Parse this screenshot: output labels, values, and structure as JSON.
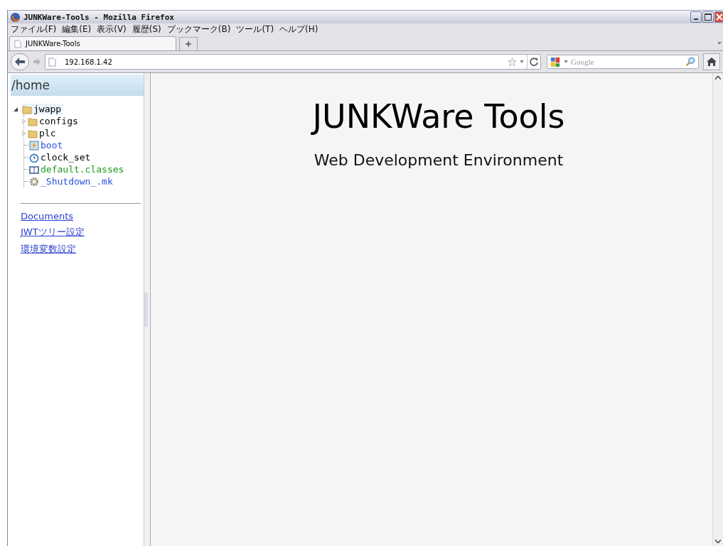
{
  "window": {
    "title": "JUNKWare-Tools - Mozilla Firefox"
  },
  "menu": [
    "ファイル(F)",
    "編集(E)",
    "表示(V)",
    "履歴(S)",
    "ブックマーク(B)",
    "ツール(T)",
    "ヘルプ(H)"
  ],
  "tabs": [
    {
      "label": "JUNKWare-Tools",
      "selected": true
    }
  ],
  "address": {
    "value": "192.168.1.42"
  },
  "search": {
    "placeholder": "Google"
  },
  "sidebar": {
    "title": "/home",
    "tree": [
      {
        "label": "jwapp",
        "kind": "folder",
        "expanded": true,
        "color": "#000000",
        "children": [
          {
            "label": "configs",
            "kind": "folder",
            "expanded": false,
            "color": "#000000"
          },
          {
            "label": "plc",
            "kind": "folder",
            "expanded": false,
            "color": "#000000"
          },
          {
            "label": "boot",
            "kind": "script",
            "color": "#2a4fe0"
          },
          {
            "label": "clock_set",
            "kind": "clock",
            "color": "#000000"
          },
          {
            "label": "default.classes",
            "kind": "book",
            "color": "#1e9a1e"
          },
          {
            "label": "_Shutdown_.mk",
            "kind": "gear",
            "color": "#2a4fe0"
          }
        ]
      }
    ],
    "links": [
      "Documents",
      "JWTツリー設定",
      "環境変数設定"
    ]
  },
  "main": {
    "heading": "JUNKWare Tools",
    "subheading": "Web Development Environment"
  }
}
